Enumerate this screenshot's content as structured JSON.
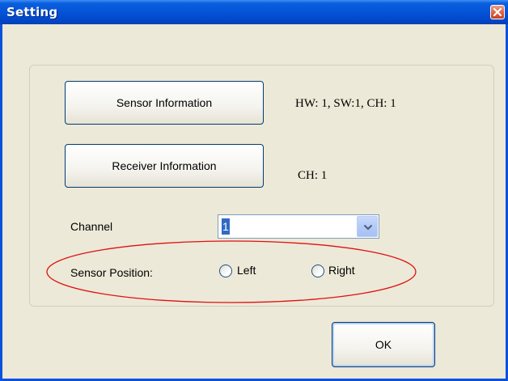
{
  "window": {
    "title": "Setting"
  },
  "buttons": {
    "sensor_information": "Sensor Information",
    "receiver_information": "Receiver Information",
    "ok": "OK"
  },
  "info": {
    "sensor": "HW: 1, SW:1, CH: 1",
    "receiver": "CH: 1"
  },
  "channel": {
    "label": "Channel",
    "selected_value": "1"
  },
  "sensor_position": {
    "label": "Sensor Position:",
    "options": [
      "Left",
      "Right"
    ]
  },
  "colors": {
    "titlebar": "#0453d8",
    "annotation_ellipse": "#e01010",
    "dialog_background": "#ece9d8"
  },
  "icons": {
    "close": "close-icon",
    "dropdown": "chevron-down-icon"
  }
}
